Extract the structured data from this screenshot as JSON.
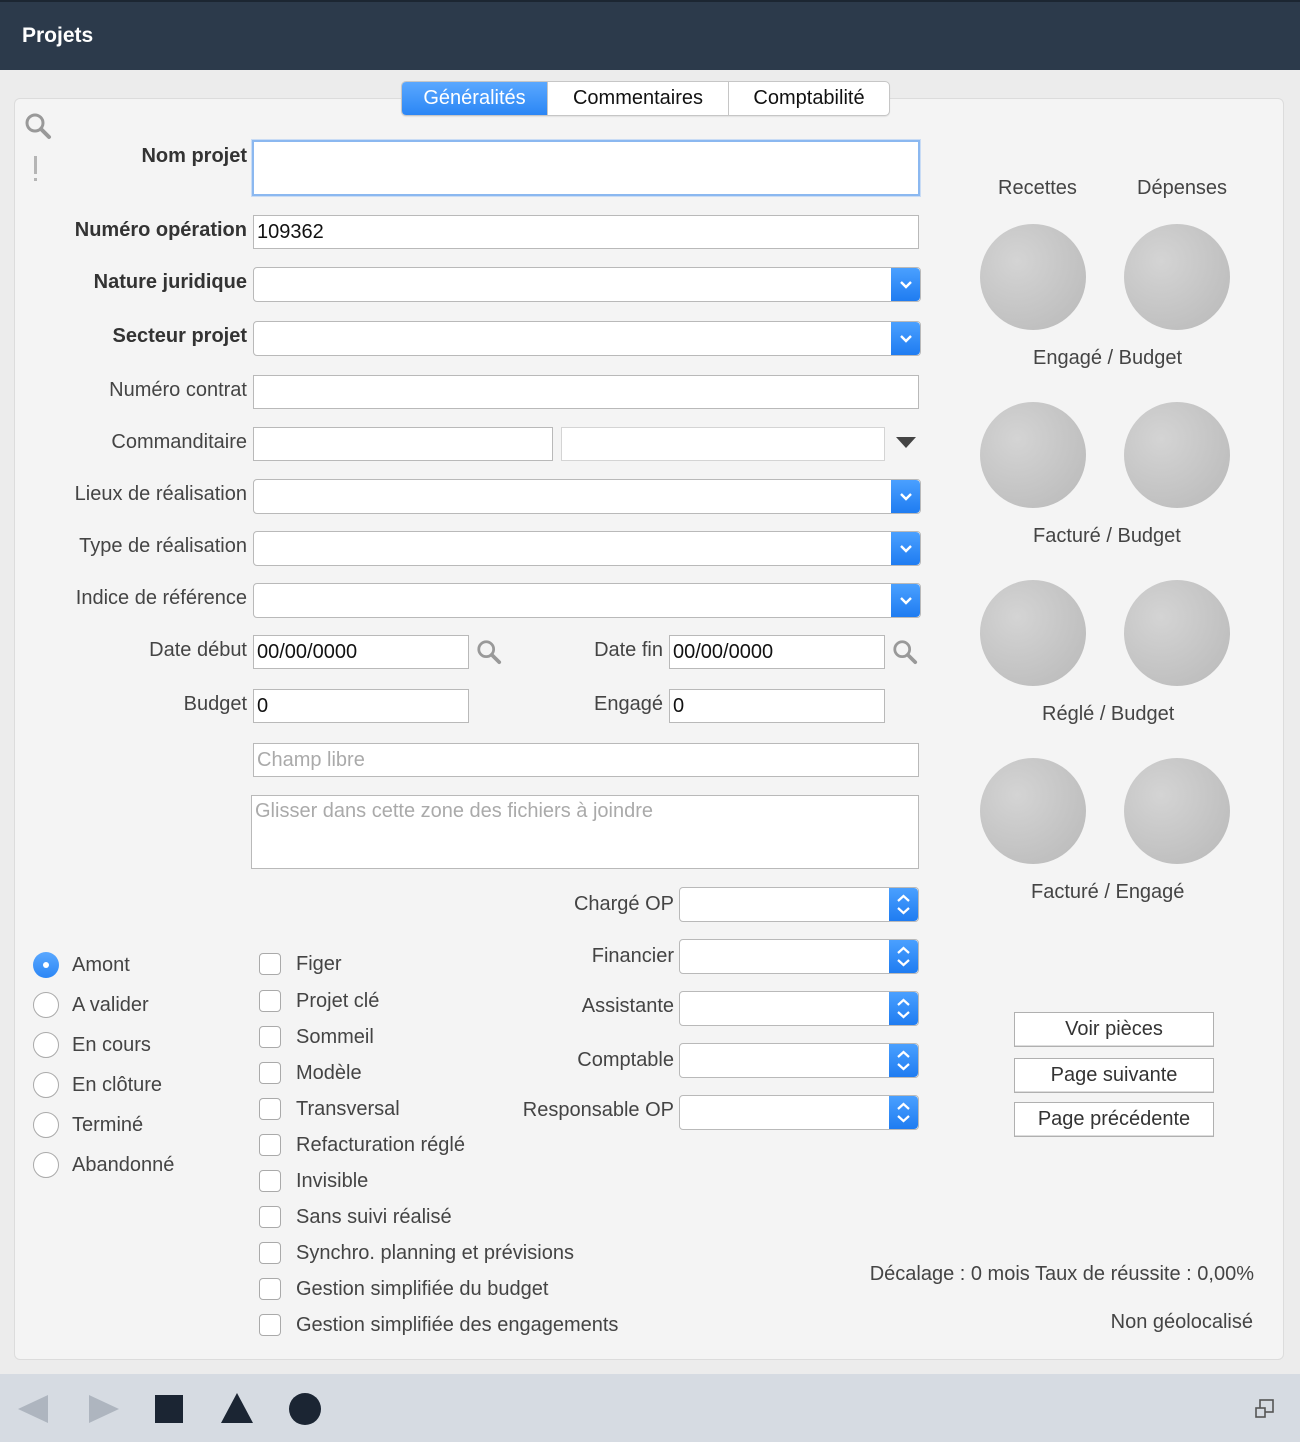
{
  "window": {
    "title": "Projets"
  },
  "tabs": [
    {
      "label": "Généralités",
      "active": true
    },
    {
      "label": "Commentaires",
      "active": false
    },
    {
      "label": "Comptabilité",
      "active": false
    }
  ],
  "form": {
    "nom_projet": {
      "label": "Nom projet",
      "value": ""
    },
    "numero_operation": {
      "label": "Numéro opération",
      "value": "109362"
    },
    "nature_juridique": {
      "label": "Nature juridique",
      "value": ""
    },
    "secteur_projet": {
      "label": "Secteur projet",
      "value": ""
    },
    "numero_contrat": {
      "label": "Numéro contrat",
      "value": ""
    },
    "commanditaire": {
      "label": "Commanditaire",
      "value1": "",
      "value2": ""
    },
    "lieux_realisation": {
      "label": "Lieux de réalisation",
      "value": ""
    },
    "type_realisation": {
      "label": "Type de réalisation",
      "value": ""
    },
    "indice_reference": {
      "label": "Indice de référence",
      "value": ""
    },
    "date_debut": {
      "label": "Date début",
      "value": "00/00/0000"
    },
    "date_fin": {
      "label": "Date fin",
      "value": "00/00/0000"
    },
    "budget": {
      "label": "Budget",
      "value": "0"
    },
    "engage": {
      "label": "Engagé",
      "value": "0"
    },
    "champ_libre": {
      "placeholder": "Champ libre"
    },
    "attachments": {
      "placeholder": "Glisser dans cette zone des fichiers à joindre"
    }
  },
  "side_stats": {
    "col_headers": [
      "Recettes",
      "Dépenses"
    ],
    "ratio_labels": [
      "Engagé / Budget",
      "Facturé / Budget",
      "Réglé / Budget",
      "Facturé / Engagé"
    ]
  },
  "status_radios": [
    {
      "label": "Amont",
      "selected": true
    },
    {
      "label": "A valider",
      "selected": false
    },
    {
      "label": "En cours",
      "selected": false
    },
    {
      "label": "En clôture",
      "selected": false
    },
    {
      "label": "Terminé",
      "selected": false
    },
    {
      "label": "Abandonné",
      "selected": false
    }
  ],
  "options": [
    {
      "label": "Figer",
      "checked": false
    },
    {
      "label": "Projet clé",
      "checked": false
    },
    {
      "label": "Sommeil",
      "checked": false
    },
    {
      "label": "Modèle",
      "checked": false
    },
    {
      "label": "Transversal",
      "checked": false
    },
    {
      "label": "Refacturation réglé",
      "checked": false
    },
    {
      "label": "Invisible",
      "checked": false
    },
    {
      "label": "Sans suivi réalisé",
      "checked": false
    },
    {
      "label": "Synchro. planning et prévisions",
      "checked": false
    },
    {
      "label": "Gestion simplifiée du budget",
      "checked": false
    },
    {
      "label": "Gestion simplifiée des engagements",
      "checked": false
    }
  ],
  "people": [
    {
      "label": "Chargé OP",
      "value": ""
    },
    {
      "label": "Financier",
      "value": ""
    },
    {
      "label": "Assistante",
      "value": ""
    },
    {
      "label": "Comptable",
      "value": ""
    },
    {
      "label": "Responsable OP",
      "value": ""
    }
  ],
  "buttons": {
    "voir_pieces": "Voir pièces",
    "page_suivante": "Page suivante",
    "page_precedente": "Page précédente"
  },
  "status_info": {
    "decalage": "Décalage : 0 mois Taux de réussite : 0,00%",
    "geoloc": "Non géolocalisé"
  },
  "icons": {
    "search": "search-icon",
    "alert": "exclamation-icon",
    "combo": "chevron-down-icon",
    "stepper": "up-down-arrows-icon",
    "footer": [
      "back-arrow-icon",
      "forward-arrow-icon",
      "square-icon",
      "triangle-icon",
      "circle-icon",
      "window-resize-icon"
    ]
  },
  "colors": {
    "titlebar": "#2c3a4b",
    "accent": "#2b86f5",
    "footer": "#d6dbe2"
  }
}
